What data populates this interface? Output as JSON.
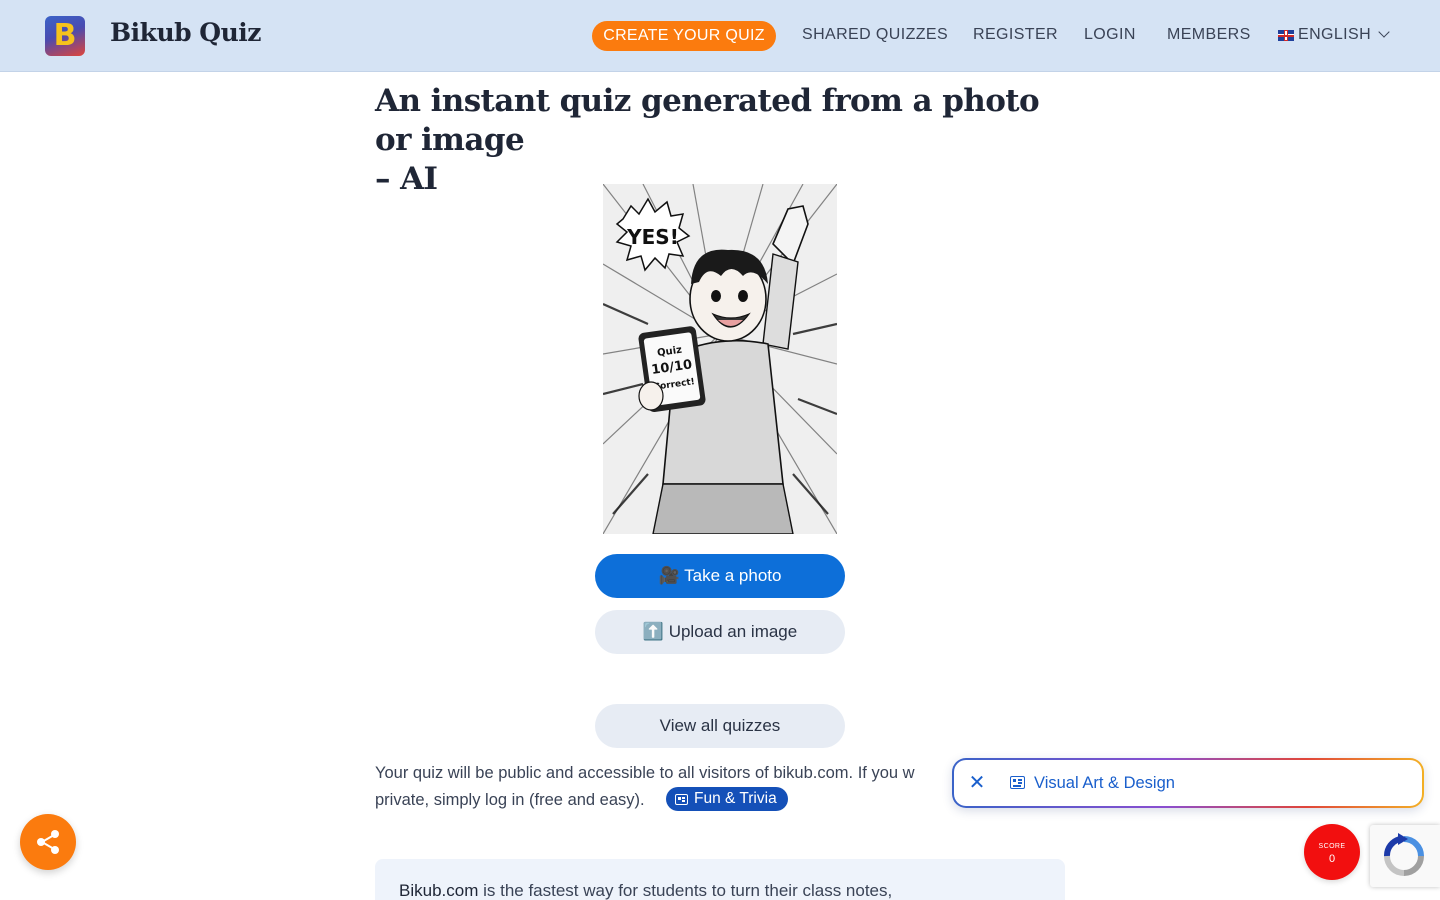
{
  "header": {
    "logo_letter": "B",
    "brand": "Bikub Quiz",
    "nav": {
      "create": "CREATE YOUR QUIZ",
      "shared": "SHARED QUIZZES",
      "register": "REGISTER",
      "login": "LOGIN",
      "members": "MEMBERS",
      "language": "ENGLISH"
    }
  },
  "main": {
    "title_line1": "An instant quiz generated from a photo or image",
    "title_line2": "– AI",
    "illustration": {
      "speech": "YES!",
      "tablet_line1": "Quiz",
      "tablet_line2": "10/10",
      "tablet_line3": "Correct!"
    },
    "take_photo_icon": "🎥",
    "take_photo": "Take a photo",
    "upload_icon": "⬆️",
    "upload": "Upload an image",
    "view_all": "View all quizzes",
    "paragraph_line1": "Your quiz will be public and accessible to all visitors of bikub.com. If you w",
    "paragraph_line2": "private, simply log in (free and easy).",
    "tag": "Fun & Trivia",
    "info_strong": "Bikub.com",
    "info_rest": " is the fastest way for students to turn their class notes,"
  },
  "category_popup": {
    "close_icon": "✕",
    "label": "Visual Art & Design"
  },
  "score": {
    "label": "SCORE",
    "value": "0"
  },
  "colors": {
    "header_bg": "#d5e3f4",
    "accent_orange": "#fb7b0e",
    "primary_blue": "#0d6fd9",
    "tag_blue": "#1450b8",
    "score_red": "#f20f0f"
  }
}
